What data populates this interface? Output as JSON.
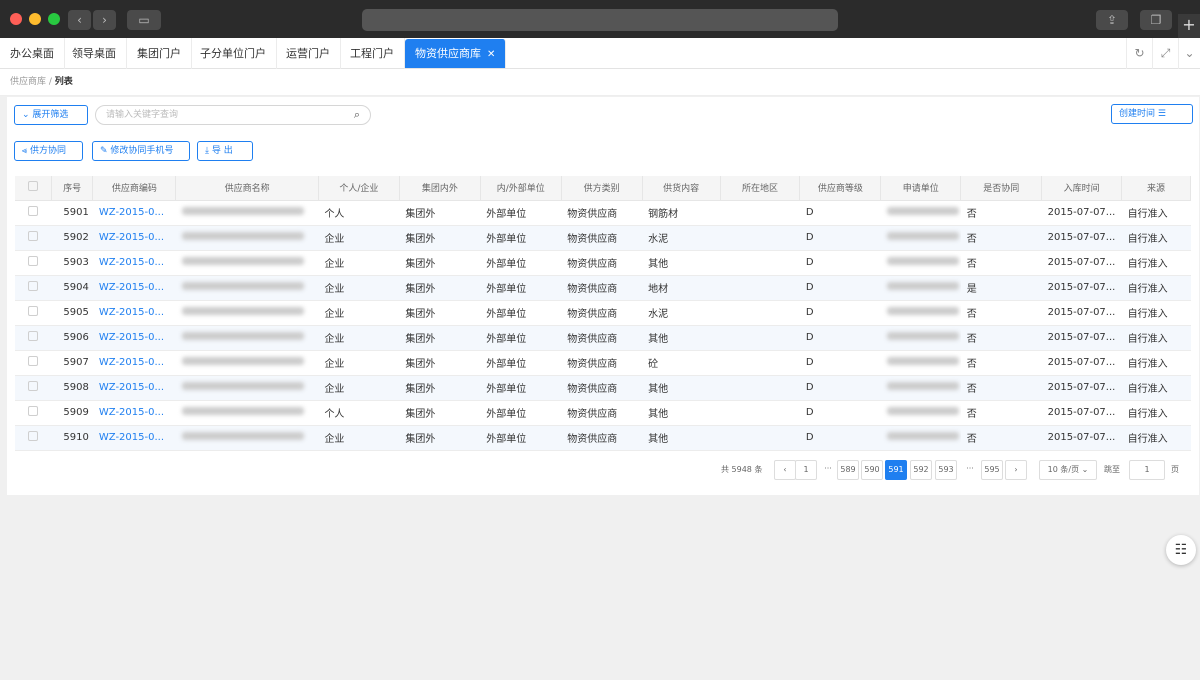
{
  "tabs": [
    "办公桌面",
    "领导桌面",
    "集团门户",
    "子分单位门户",
    "运营门户",
    "工程门户",
    "物资供应商库"
  ],
  "breadcrumb": {
    "parent": "供应商库",
    "current": "列表"
  },
  "toolbar": {
    "filter_label": "展开筛选",
    "search_placeholder": "请输入关键字查询",
    "sort_label": "创建时间",
    "supply_coop_label": "供方协同",
    "edit_phone_label": "修改协同手机号",
    "export_label": "导 出"
  },
  "table": {
    "headers": [
      "序号",
      "供应商编码",
      "供应商名称",
      "个人/企业",
      "集团内外",
      "内/外部单位",
      "供方类别",
      "供货内容",
      "所在地区",
      "供应商等级",
      "申请单位",
      "是否协同",
      "入库时间",
      "来源"
    ],
    "rows": [
      {
        "no": "5901",
        "code": "WZ-2015-0...",
        "type": "个人",
        "group": "集团外",
        "unit": "外部单位",
        "cat": "物资供应商",
        "content": "钢筋材",
        "region": "",
        "level": "D",
        "coop": "否",
        "date": "2015-07-07...",
        "source": "自行准入"
      },
      {
        "no": "5902",
        "code": "WZ-2015-0...",
        "type": "企业",
        "group": "集团外",
        "unit": "外部单位",
        "cat": "物资供应商",
        "content": "水泥",
        "region": "",
        "level": "D",
        "coop": "否",
        "date": "2015-07-07...",
        "source": "自行准入"
      },
      {
        "no": "5903",
        "code": "WZ-2015-0...",
        "type": "企业",
        "group": "集团外",
        "unit": "外部单位",
        "cat": "物资供应商",
        "content": "其他",
        "region": "",
        "level": "D",
        "coop": "否",
        "date": "2015-07-07...",
        "source": "自行准入"
      },
      {
        "no": "5904",
        "code": "WZ-2015-0...",
        "type": "企业",
        "group": "集团外",
        "unit": "外部单位",
        "cat": "物资供应商",
        "content": "地材",
        "region": "",
        "level": "D",
        "coop": "是",
        "date": "2015-07-07...",
        "source": "自行准入"
      },
      {
        "no": "5905",
        "code": "WZ-2015-0...",
        "type": "企业",
        "group": "集团外",
        "unit": "外部单位",
        "cat": "物资供应商",
        "content": "水泥",
        "region": "",
        "level": "D",
        "coop": "否",
        "date": "2015-07-07...",
        "source": "自行准入"
      },
      {
        "no": "5906",
        "code": "WZ-2015-0...",
        "type": "企业",
        "group": "集团外",
        "unit": "外部单位",
        "cat": "物资供应商",
        "content": "其他",
        "region": "",
        "level": "D",
        "coop": "否",
        "date": "2015-07-07...",
        "source": "自行准入"
      },
      {
        "no": "5907",
        "code": "WZ-2015-0...",
        "type": "企业",
        "group": "集团外",
        "unit": "外部单位",
        "cat": "物资供应商",
        "content": "砼",
        "region": "",
        "level": "D",
        "coop": "否",
        "date": "2015-07-07...",
        "source": "自行准入"
      },
      {
        "no": "5908",
        "code": "WZ-2015-0...",
        "type": "企业",
        "group": "集团外",
        "unit": "外部单位",
        "cat": "物资供应商",
        "content": "其他",
        "region": "",
        "level": "D",
        "coop": "否",
        "date": "2015-07-07...",
        "source": "自行准入"
      },
      {
        "no": "5909",
        "code": "WZ-2015-0...",
        "type": "个人",
        "group": "集团外",
        "unit": "外部单位",
        "cat": "物资供应商",
        "content": "其他",
        "region": "",
        "level": "D",
        "coop": "否",
        "date": "2015-07-07...",
        "source": "自行准入"
      },
      {
        "no": "5910",
        "code": "WZ-2015-0...",
        "type": "企业",
        "group": "集团外",
        "unit": "外部单位",
        "cat": "物资供应商",
        "content": "其他",
        "region": "",
        "level": "D",
        "coop": "否",
        "date": "2015-07-07...",
        "source": "自行准入"
      }
    ]
  },
  "pagination": {
    "total": "共 5948 条",
    "pages": [
      "1",
      "589",
      "590",
      "591",
      "592",
      "593",
      "595"
    ],
    "current": "591",
    "ellipsis": "···",
    "page_size": "10 条/页",
    "goto_label": "跳至",
    "goto_value": "1",
    "page_suffix": "页"
  },
  "colors": {
    "accent": "#1f7ff0"
  }
}
